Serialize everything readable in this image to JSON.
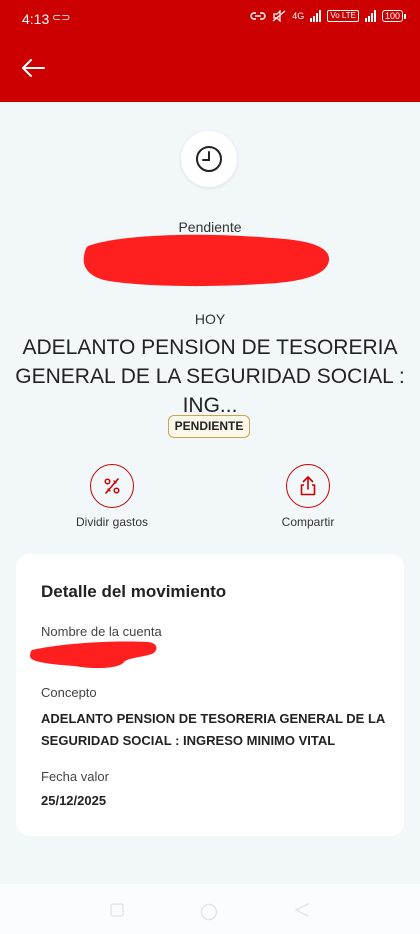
{
  "status_bar": {
    "time": "4:13",
    "network_label": "4G",
    "volte_label": "Vo LTE",
    "battery": "100"
  },
  "header": {
    "back_icon": "arrow-left-icon",
    "color": "#cc0000"
  },
  "transaction": {
    "status": "Pendiente",
    "day": "HOY",
    "title": "ADELANTO PENSION DE TESORERIA GENERAL DE LA SEGURIDAD SOCIAL : ING...",
    "badge": "PENDIENTE"
  },
  "actions": [
    {
      "label": "Dividir gastos",
      "icon": "percent-split-icon"
    },
    {
      "label": "Compartir",
      "icon": "share-icon"
    }
  ],
  "detail": {
    "title": "Detalle del movimiento",
    "account_label": "Nombre de la cuenta",
    "concept_label": "Concepto",
    "concept_value": "ADELANTO PENSION DE TESORERIA GENERAL DE LA SEGURIDAD SOCIAL : INGRESO MINIMO VITAL",
    "date_label": "Fecha valor",
    "date_value": "25/12/2025"
  },
  "colors": {
    "accent": "#cc0000",
    "badge_border": "#c9a64c",
    "background": "#f2f8fa"
  }
}
